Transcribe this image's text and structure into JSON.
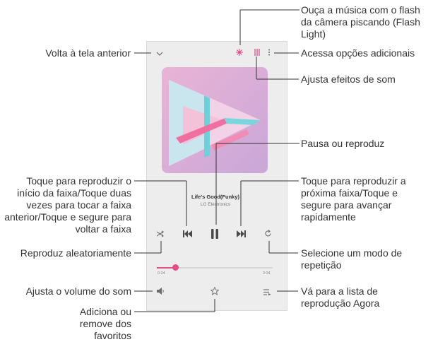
{
  "player": {
    "song_title": "Life's Good(Funky)",
    "artist": "LG Electronics",
    "time_elapsed": "0:24",
    "time_total": "3:34",
    "progress": 0.14,
    "accent_color": "#e24d86"
  },
  "callouts": {
    "flash": "Ouça a música com o flash da câmera piscando (Flash Light)",
    "back": "Volta à tela anterior",
    "more": "Acessa opções adicionais",
    "effects": "Ajusta efeitos de som",
    "pause": "Pausa ou reproduz",
    "previous": "Toque para reproduzir o início da faixa/Toque duas vezes para tocar a faixa anterior/Toque e segure para voltar a faixa",
    "next": "Toque para reproduzir a próxima faixa/Toque e segure para avançar rapidamente",
    "shuffle": "Reproduz aleatoriamente",
    "repeat": "Selecione um modo de repetição",
    "volume": "Ajusta o volume do som",
    "playlist": "Vá para a lista de reprodução Agora",
    "favorite": "Adiciona ou remove dos favoritos"
  },
  "icons": {
    "back": "chevron-down-icon",
    "flash": "flash-light-icon",
    "effects": "equalizer-icon",
    "more": "more-vertical-icon",
    "shuffle": "shuffle-icon",
    "previous": "skip-previous-icon",
    "pause": "pause-icon",
    "next": "skip-next-icon",
    "repeat": "repeat-icon",
    "volume": "volume-icon",
    "favorite": "star-icon",
    "playlist": "playlist-icon"
  }
}
